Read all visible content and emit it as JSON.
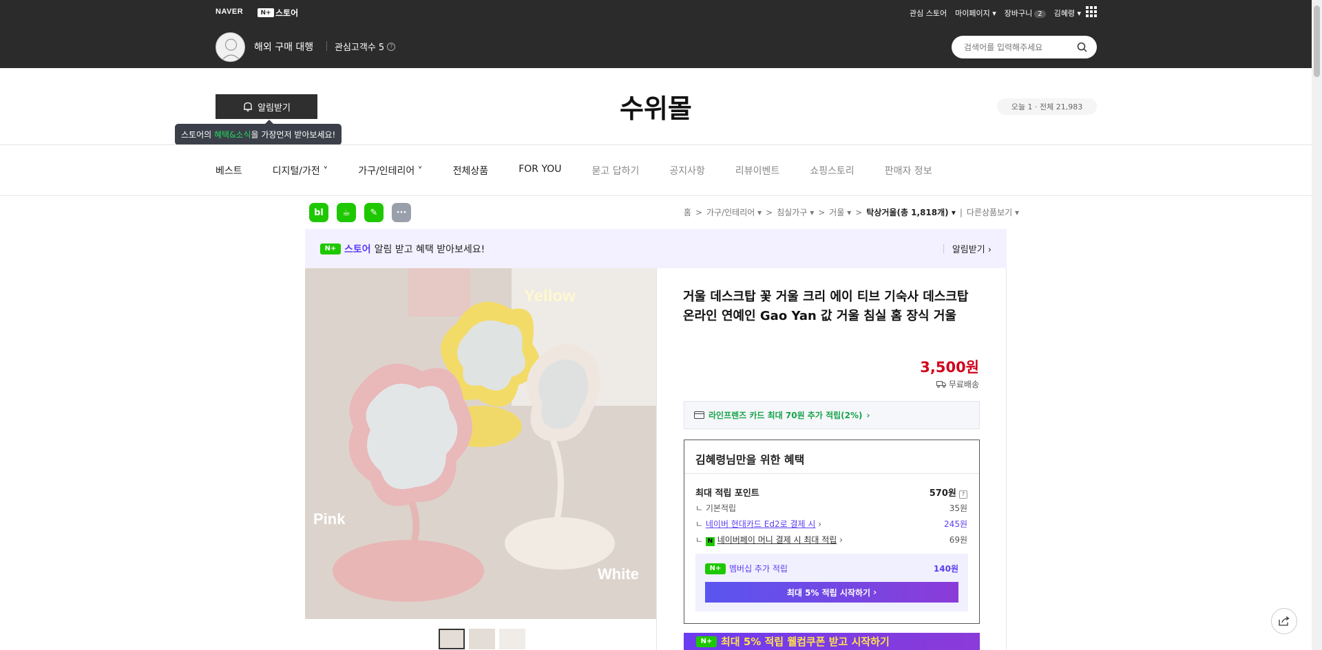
{
  "top_header": {
    "naver_logo": "NAVER",
    "nplus_box": "N+",
    "store_word": "스토어",
    "links": [
      "관심 스토어",
      "마이페이지",
      "장바구니",
      "김혜령"
    ],
    "cart_count": "2",
    "store_name": "해외 구매 대행",
    "follower_label": "관심고객수 5",
    "search_placeholder": "검색어를 입력해주세요"
  },
  "store_header": {
    "alarm_button": "알림받기",
    "tip_pre": "스토어의 ",
    "tip_highlight": "혜택&소식",
    "tip_post": "을 가장먼저 받아보세요!",
    "title": "수위몰",
    "visitor": "오늘 1 · 전체 21,983"
  },
  "nav": {
    "items": [
      "베스트",
      "디지털/가전",
      "가구/인테리어",
      "전체상품",
      "FOR YOU",
      "묻고 답하기",
      "공지사항",
      "리뷰이벤트",
      "쇼핑스토리",
      "판매자 정보"
    ]
  },
  "sns": [
    "bl",
    "☕",
    "✎",
    "···"
  ],
  "breadcrumb": {
    "items": [
      "홈",
      "가구/인테리어",
      "침실가구",
      "거울"
    ],
    "current": "탁상거울(총 1,818개)",
    "other": "다른상품보기"
  },
  "npromo": {
    "text": "알림 받고 혜택 받아보세요!",
    "action": "알림받기"
  },
  "product": {
    "image_labels": {
      "yellow": "Yellow",
      "pink": "Pink",
      "white": "White"
    },
    "title": "거울 데스크탑 꽃 거울 크리 에이 티브 기숙사 데스크탑 온라인 연예인 Gao Yan 값 거울 침실 홈 장식 거울",
    "price": "3,500원",
    "shipping": "무료배송",
    "card_promo": "라인프렌즈 카드 최대 70원 추가 적립(2%)",
    "benefit": {
      "title": "김혜령님만을 위한 혜택",
      "max_label": "최대 적립 포인트",
      "max_value": "570원",
      "rows": [
        {
          "label": "기본적립",
          "value": "35원"
        },
        {
          "label": "네이버 현대카드 Ed2로 결제 시",
          "value": "245원"
        },
        {
          "label": "네이버페이 머니 결제 시 최대 적립",
          "value": "69원"
        }
      ],
      "membership_label": "멤버십 추가 적립",
      "membership_value": "140원",
      "membership_button": "최대 5% 적립 시작하기"
    },
    "bottom_banner": "최대 5% 적립 웰컴쿠폰 받고 시작하기"
  },
  "colors": {
    "header_bg": "#2b2b2b",
    "price_red": "#d0021b",
    "naver_green": "#1ec800",
    "purple": "#5c3df0"
  }
}
